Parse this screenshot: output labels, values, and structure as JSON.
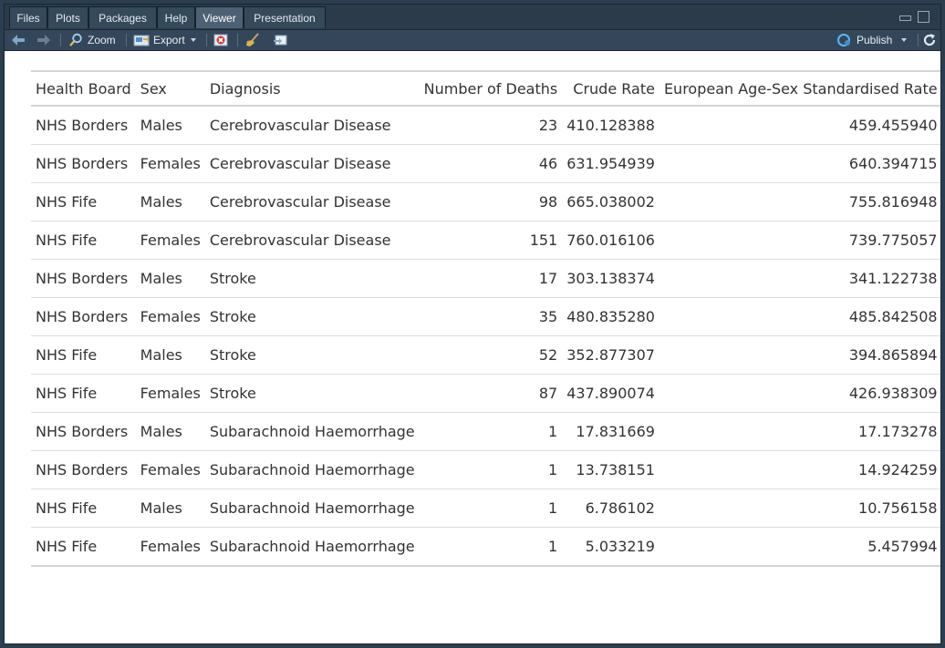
{
  "tabs": [
    "Files",
    "Plots",
    "Packages",
    "Help",
    "Viewer",
    "Presentation"
  ],
  "active_tab": "Viewer",
  "toolbar": {
    "zoom_label": "Zoom",
    "export_label": "Export",
    "publish_label": "Publish"
  },
  "colors": {
    "tab_bar": "#2b3b4a",
    "toolbar": "#34475a",
    "accent_publish": "#5fb4f0"
  },
  "table": {
    "headers": [
      "Health Board",
      "Sex",
      "Diagnosis",
      "Number of Deaths",
      "Crude Rate",
      "European Age-Sex Standardised Rate"
    ],
    "rows": [
      [
        "NHS Borders",
        "Males",
        "Cerebrovascular Disease",
        "23",
        "410.128388",
        "459.455940"
      ],
      [
        "NHS Borders",
        "Females",
        "Cerebrovascular Disease",
        "46",
        "631.954939",
        "640.394715"
      ],
      [
        "NHS Fife",
        "Males",
        "Cerebrovascular Disease",
        "98",
        "665.038002",
        "755.816948"
      ],
      [
        "NHS Fife",
        "Females",
        "Cerebrovascular Disease",
        "151",
        "760.016106",
        "739.775057"
      ],
      [
        "NHS Borders",
        "Males",
        "Stroke",
        "17",
        "303.138374",
        "341.122738"
      ],
      [
        "NHS Borders",
        "Females",
        "Stroke",
        "35",
        "480.835280",
        "485.842508"
      ],
      [
        "NHS Fife",
        "Males",
        "Stroke",
        "52",
        "352.877307",
        "394.865894"
      ],
      [
        "NHS Fife",
        "Females",
        "Stroke",
        "87",
        "437.890074",
        "426.938309"
      ],
      [
        "NHS Borders",
        "Males",
        "Subarachnoid Haemorrhage",
        "1",
        "17.831669",
        "17.173278"
      ],
      [
        "NHS Borders",
        "Females",
        "Subarachnoid Haemorrhage",
        "1",
        "13.738151",
        "14.924259"
      ],
      [
        "NHS Fife",
        "Males",
        "Subarachnoid Haemorrhage",
        "1",
        "6.786102",
        "10.756158"
      ],
      [
        "NHS Fife",
        "Females",
        "Subarachnoid Haemorrhage",
        "1",
        "5.033219",
        "5.457994"
      ]
    ]
  }
}
